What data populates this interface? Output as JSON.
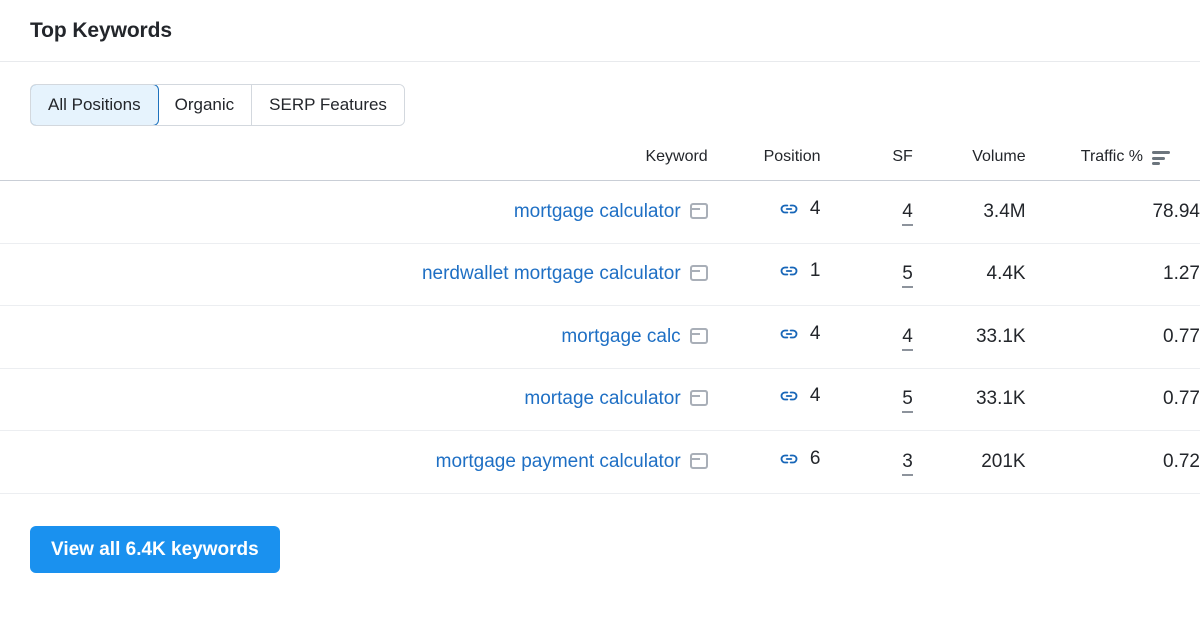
{
  "header": {
    "title": "Top Keywords"
  },
  "tabs": [
    {
      "label": "All Positions",
      "active": true
    },
    {
      "label": "Organic",
      "active": false
    },
    {
      "label": "SERP Features",
      "active": false
    }
  ],
  "table": {
    "columns": {
      "keyword": "Keyword",
      "position": "Position",
      "sf": "SF",
      "volume": "Volume",
      "traffic": "Traffic %"
    },
    "sort_icon": "sort-descending-icon",
    "sorted_by": "Traffic %",
    "rows": [
      {
        "keyword": "mortgage calculator",
        "serp_icon": "serp-feature-icon",
        "position_icon": "link-icon",
        "position": "4",
        "sf": "4",
        "volume": "3.4M",
        "traffic": "78.94"
      },
      {
        "keyword": "nerdwallet mortgage calculator",
        "serp_icon": "serp-feature-icon",
        "position_icon": "link-icon",
        "position": "1",
        "sf": "5",
        "volume": "4.4K",
        "traffic": "1.27"
      },
      {
        "keyword": "mortgage calc",
        "serp_icon": "serp-feature-icon",
        "position_icon": "link-icon",
        "position": "4",
        "sf": "4",
        "volume": "33.1K",
        "traffic": "0.77"
      },
      {
        "keyword": "mortage calculator",
        "serp_icon": "serp-feature-icon",
        "position_icon": "link-icon",
        "position": "4",
        "sf": "5",
        "volume": "33.1K",
        "traffic": "0.77"
      },
      {
        "keyword": "mortgage payment calculator",
        "serp_icon": "serp-feature-icon",
        "position_icon": "link-icon",
        "position": "6",
        "sf": "3",
        "volume": "201K",
        "traffic": "0.72"
      }
    ]
  },
  "footer": {
    "view_all_label": "View all 6.4K keywords"
  },
  "colors": {
    "accent_blue": "#1a91ef",
    "link_blue": "#1e6fc4",
    "active_tab_bg": "#e6f3fd",
    "active_tab_border": "#1e72bd",
    "text": "#23262b",
    "icon_gray": "#a9afb8",
    "border": "#e8eaed"
  }
}
